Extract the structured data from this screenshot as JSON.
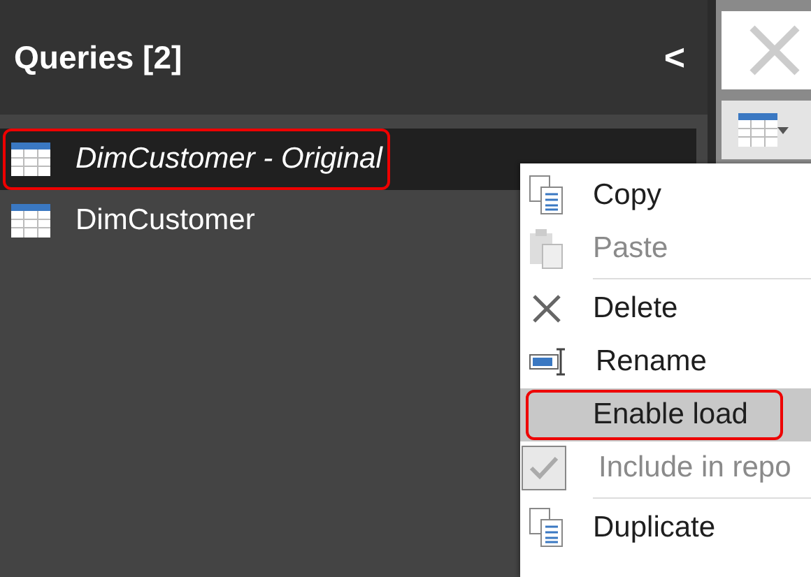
{
  "panel": {
    "title": "Queries [2]",
    "collapse_glyph": "<"
  },
  "queries": [
    {
      "name": "DimCustomer - Original",
      "selected": true,
      "outlined": true
    },
    {
      "name": "DimCustomer",
      "selected": false,
      "outlined": false
    }
  ],
  "context_menu": [
    {
      "kind": "action",
      "label": "Copy",
      "disabled": false,
      "hovered": false,
      "outlined": false
    },
    {
      "kind": "action",
      "label": "Paste",
      "disabled": true,
      "hovered": false,
      "outlined": false
    },
    {
      "kind": "separator"
    },
    {
      "kind": "action",
      "label": "Delete",
      "disabled": false,
      "hovered": false,
      "outlined": false
    },
    {
      "kind": "action",
      "label": "Rename",
      "disabled": false,
      "hovered": false,
      "outlined": false
    },
    {
      "kind": "action",
      "label": "Enable load",
      "disabled": false,
      "hovered": true,
      "outlined": true
    },
    {
      "kind": "check",
      "label": "Include in repo",
      "disabled": true,
      "hovered": false,
      "outlined": false,
      "checked": true
    },
    {
      "kind": "separator"
    },
    {
      "kind": "action",
      "label": "Duplicate",
      "disabled": false,
      "hovered": false,
      "outlined": false
    }
  ]
}
